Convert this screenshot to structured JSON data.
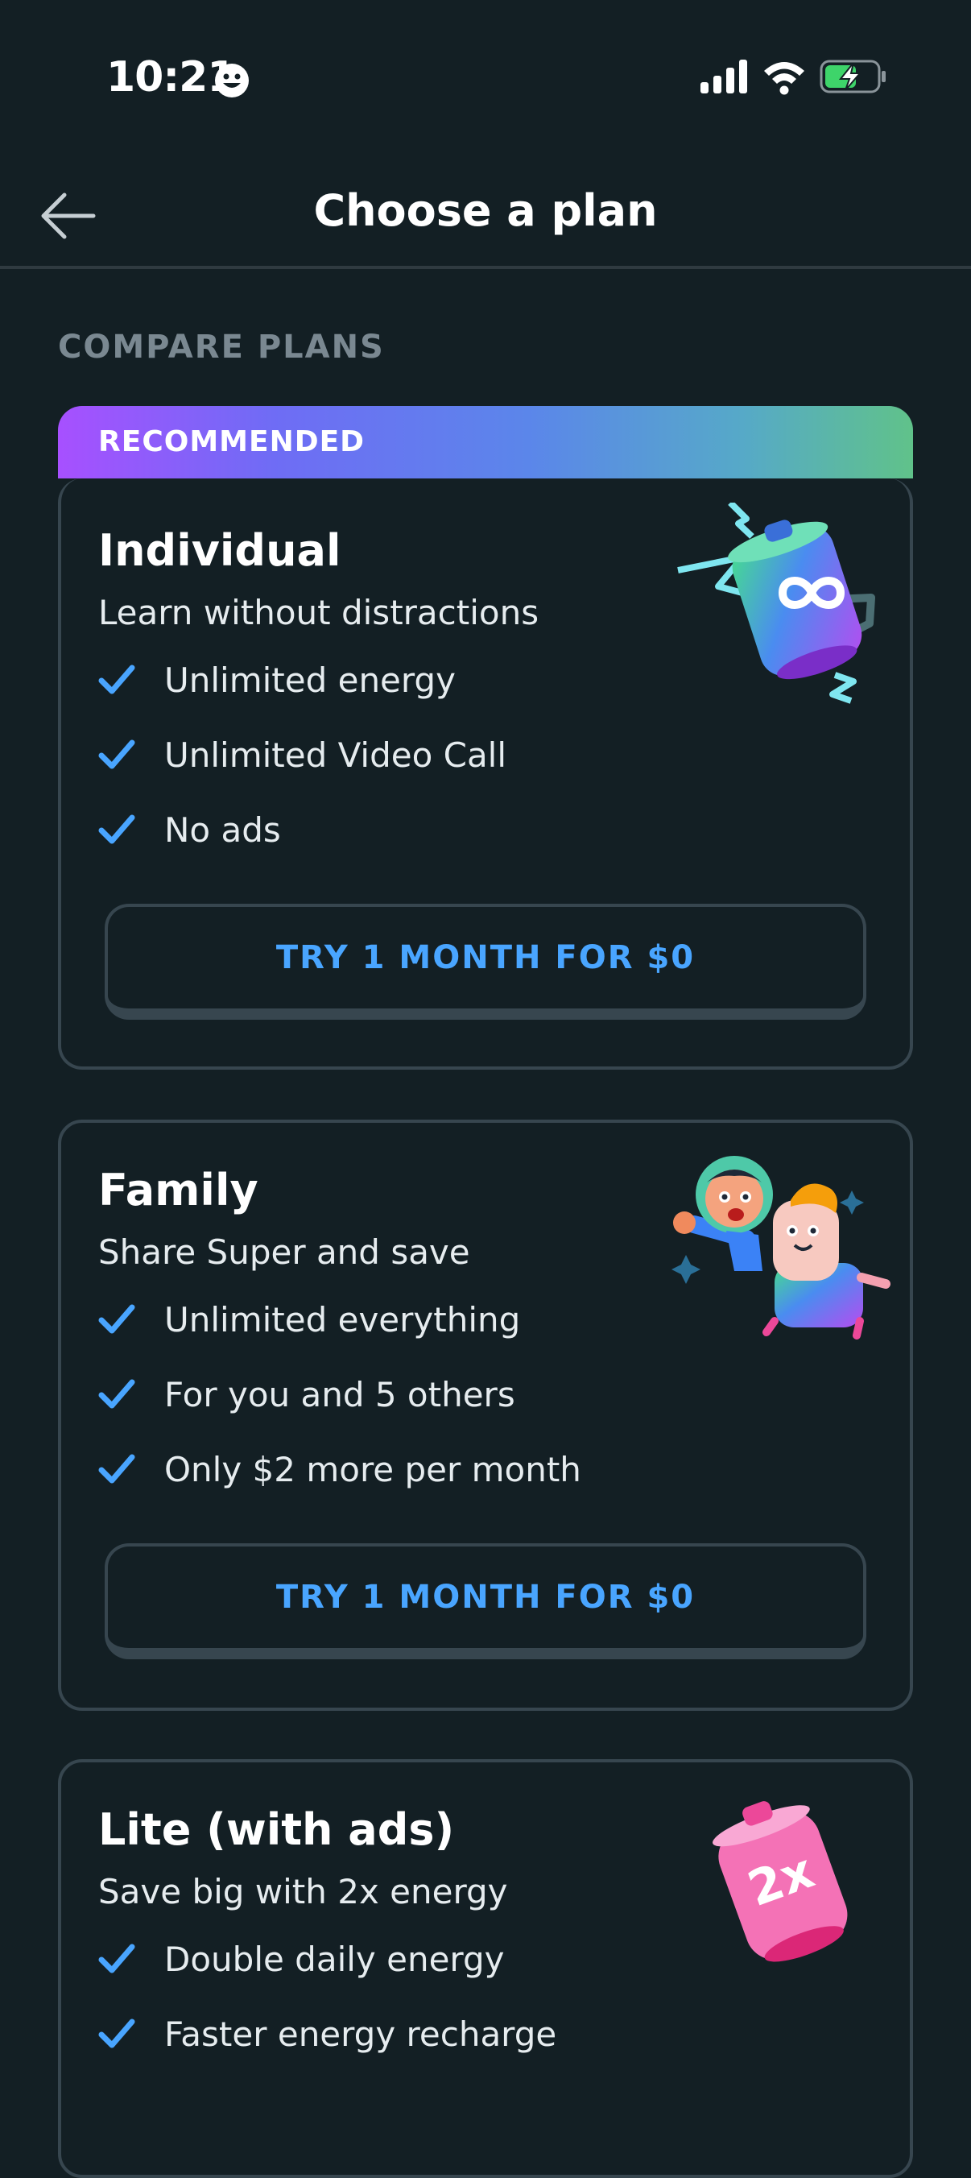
{
  "status_bar": {
    "time": "10:21",
    "emoji_icon": "smiley-face-icon",
    "icons": [
      "cellular-signal-icon",
      "wifi-icon",
      "battery-charging-icon"
    ]
  },
  "header": {
    "back_icon": "arrow-left-icon",
    "title": "Choose a plan"
  },
  "section_label": "COMPARE PLANS",
  "colors": {
    "background": "#131f24",
    "card_border": "#37464f",
    "check": "#49a5ff",
    "button_text": "#49a5ff",
    "banner_gradient": [
      "#a750ff",
      "#5b86ea",
      "#60c28a"
    ]
  },
  "plans": [
    {
      "badge": "RECOMMENDED",
      "name": "Individual",
      "subtitle": "Learn without distractions",
      "features": [
        "Unlimited energy",
        "Unlimited Video Call",
        "No ads"
      ],
      "cta": "TRY 1 MONTH FOR $0",
      "illustration": "infinity-energy-battery-illustration"
    },
    {
      "name": "Family",
      "subtitle": "Share Super and save",
      "features": [
        "Unlimited everything",
        "For you and 5 others",
        "Only $2 more per month"
      ],
      "cta": "TRY 1 MONTH FOR $0",
      "illustration": "flying-characters-illustration"
    },
    {
      "name": "Lite (with ads)",
      "subtitle": "Save big with 2x energy",
      "features": [
        "Double daily energy",
        "Faster energy recharge"
      ],
      "illustration": "2x-battery-illustration",
      "illustration_text": "2x"
    }
  ]
}
